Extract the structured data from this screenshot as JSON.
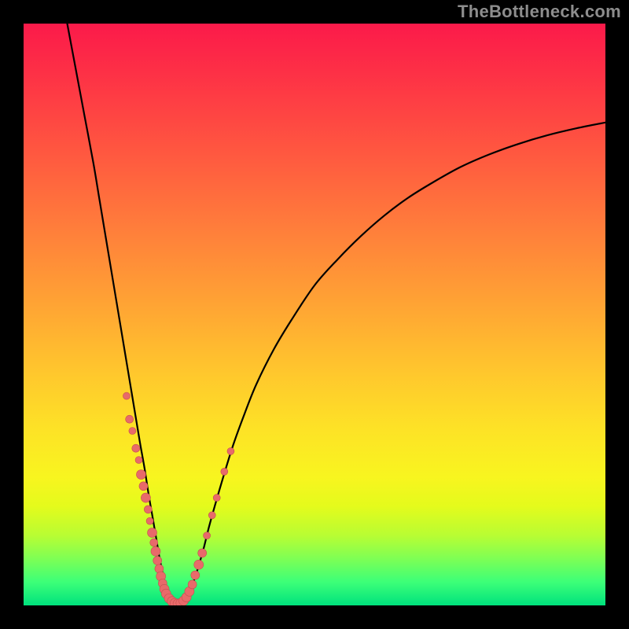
{
  "watermark": {
    "text": "TheBottleneck.com"
  },
  "colors": {
    "curve": "#000000",
    "marker_fill": "#e86a6a",
    "marker_stroke": "#c44f4f"
  },
  "chart_data": {
    "type": "line",
    "title": "",
    "xlabel": "",
    "ylabel": "",
    "xlim": [
      0,
      100
    ],
    "ylim": [
      0,
      100
    ],
    "grid": false,
    "series": [
      {
        "name": "left-branch",
        "x": [
          7.5,
          9,
          10.5,
          12,
          13,
          14,
          15,
          16,
          17,
          18,
          19,
          20,
          20.8,
          21.5,
          22.2,
          22.8,
          23.3,
          23.8,
          24.2,
          24.6,
          25
        ],
        "values": [
          100,
          92,
          84,
          76,
          70,
          64,
          58,
          52,
          46,
          40,
          34,
          28,
          23.5,
          19,
          15,
          11.5,
          8.5,
          6,
          4,
          2.5,
          1.2
        ]
      },
      {
        "name": "valley",
        "x": [
          25,
          25.5,
          26,
          26.5,
          27,
          27.5,
          28
        ],
        "values": [
          1.2,
          0.6,
          0.3,
          0.2,
          0.3,
          0.6,
          1.2
        ]
      },
      {
        "name": "right-branch",
        "x": [
          28,
          29,
          30,
          31,
          32,
          34,
          36,
          38,
          40,
          43,
          46,
          50,
          54,
          58,
          62,
          66,
          70,
          75,
          80,
          85,
          90,
          95,
          100
        ],
        "values": [
          1.2,
          3.5,
          6.5,
          10,
          14,
          21,
          27.5,
          33,
          38,
          44,
          49,
          55,
          59.5,
          63.5,
          67,
          70,
          72.5,
          75.3,
          77.5,
          79.3,
          80.8,
          82,
          83
        ]
      }
    ],
    "markers": [
      {
        "x": 17.7,
        "y": 36.0,
        "r": 4.5
      },
      {
        "x": 18.2,
        "y": 32.0,
        "r": 5.0
      },
      {
        "x": 18.7,
        "y": 30.0,
        "r": 4.5
      },
      {
        "x": 19.3,
        "y": 27.0,
        "r": 5.0
      },
      {
        "x": 19.8,
        "y": 25.0,
        "r": 4.5
      },
      {
        "x": 20.2,
        "y": 22.5,
        "r": 6.0
      },
      {
        "x": 20.6,
        "y": 20.5,
        "r": 5.5
      },
      {
        "x": 21.0,
        "y": 18.5,
        "r": 6.0
      },
      {
        "x": 21.4,
        "y": 16.5,
        "r": 5.0
      },
      {
        "x": 21.7,
        "y": 14.5,
        "r": 4.5
      },
      {
        "x": 22.1,
        "y": 12.5,
        "r": 6.0
      },
      {
        "x": 22.4,
        "y": 10.8,
        "r": 5.0
      },
      {
        "x": 22.7,
        "y": 9.3,
        "r": 6.0
      },
      {
        "x": 23.0,
        "y": 7.7,
        "r": 5.5
      },
      {
        "x": 23.3,
        "y": 6.3,
        "r": 5.5
      },
      {
        "x": 23.6,
        "y": 5.0,
        "r": 6.0
      },
      {
        "x": 23.9,
        "y": 3.8,
        "r": 5.5
      },
      {
        "x": 24.2,
        "y": 2.8,
        "r": 6.0
      },
      {
        "x": 24.5,
        "y": 2.0,
        "r": 6.0
      },
      {
        "x": 25.0,
        "y": 1.2,
        "r": 6.0
      },
      {
        "x": 25.5,
        "y": 0.7,
        "r": 6.0
      },
      {
        "x": 26.0,
        "y": 0.4,
        "r": 6.0
      },
      {
        "x": 26.5,
        "y": 0.3,
        "r": 6.0
      },
      {
        "x": 27.0,
        "y": 0.4,
        "r": 6.0
      },
      {
        "x": 27.5,
        "y": 0.8,
        "r": 6.0
      },
      {
        "x": 28.0,
        "y": 1.4,
        "r": 6.0
      },
      {
        "x": 28.5,
        "y": 2.4,
        "r": 6.0
      },
      {
        "x": 29.0,
        "y": 3.6,
        "r": 5.5
      },
      {
        "x": 29.5,
        "y": 5.2,
        "r": 5.5
      },
      {
        "x": 30.1,
        "y": 7.0,
        "r": 6.0
      },
      {
        "x": 30.7,
        "y": 9.0,
        "r": 5.5
      },
      {
        "x": 31.5,
        "y": 12.0,
        "r": 4.5
      },
      {
        "x": 32.4,
        "y": 15.5,
        "r": 4.5
      },
      {
        "x": 33.2,
        "y": 18.5,
        "r": 4.5
      },
      {
        "x": 34.5,
        "y": 23.0,
        "r": 4.5
      },
      {
        "x": 35.6,
        "y": 26.5,
        "r": 4.5
      }
    ]
  }
}
